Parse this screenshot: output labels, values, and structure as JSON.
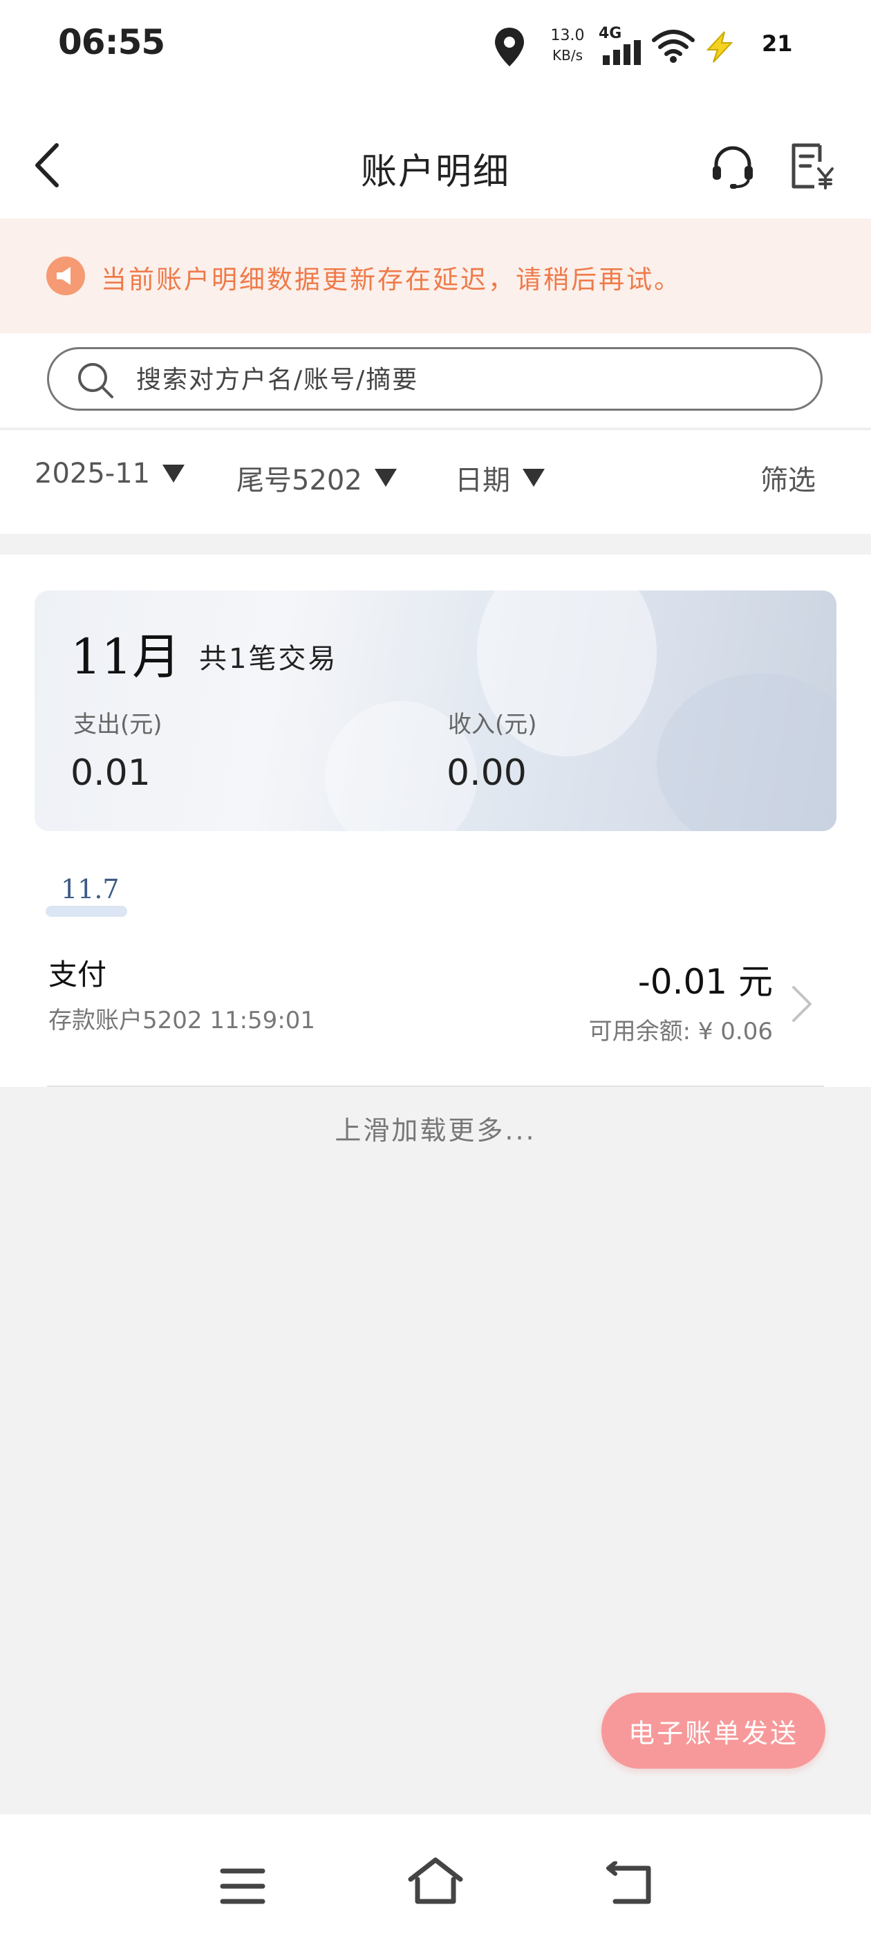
{
  "status_bar": {
    "time": "06:55",
    "net_speed_value": "13.0",
    "net_speed_unit": "KB/s",
    "network_type": "4G",
    "battery": "21"
  },
  "header": {
    "title": "账户明细"
  },
  "notice": {
    "text": "当前账户明细数据更新存在延迟，请稍后再试。"
  },
  "search": {
    "placeholder": "搜索对方户名/账号/摘要"
  },
  "filters": {
    "month": "2025-11",
    "account": "尾号5202",
    "sort": "日期",
    "filter_label": "筛选"
  },
  "summary": {
    "month": "11月",
    "count": "共1笔交易",
    "expense_label": "支出(元)",
    "expense_value": "0.01",
    "income_label": "收入(元)",
    "income_value": "0.00"
  },
  "transactions": {
    "date": "11.7",
    "items": [
      {
        "title": "支付",
        "subtitle": "存款账户5202 11:59:01",
        "amount": "-0.01 元",
        "balance": "可用余额: ¥ 0.06"
      }
    ]
  },
  "load_more": "上滑加载更多...",
  "ebill_button": "电子账单发送",
  "colors": {
    "accent_orange": "#ef7a4a",
    "notice_bg": "#fbf0eb",
    "ebill_pink": "#f7999a",
    "date_blue": "#3b5b85"
  }
}
